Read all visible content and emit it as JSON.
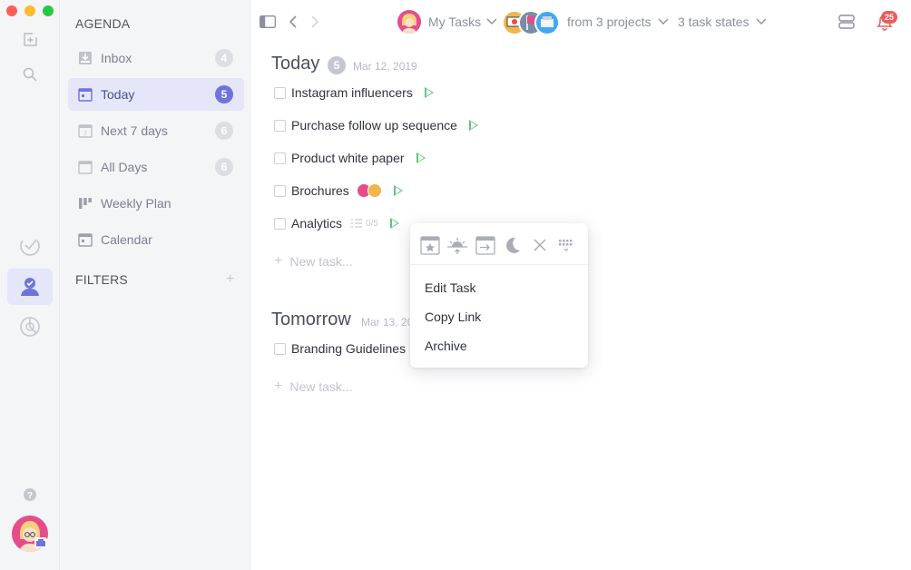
{
  "colors": {
    "accent": "#6e74d9",
    "play": "#5fc87e",
    "notification": "#ef5a5a"
  },
  "rail": {
    "icons": [
      "new-task-icon",
      "search-icon",
      "check-circle-icon",
      "user-check-icon",
      "chart-icon",
      "help-icon"
    ]
  },
  "sidebar": {
    "agenda_title": "AGENDA",
    "items": [
      {
        "label": "Inbox",
        "badge": "4",
        "icon": "inbox-icon"
      },
      {
        "label": "Today",
        "badge": "5",
        "icon": "calendar-today-icon"
      },
      {
        "label": "Next 7 days",
        "badge": "6",
        "icon": "calendar-7-icon"
      },
      {
        "label": "All Days",
        "badge": "6",
        "icon": "calendar-all-icon"
      },
      {
        "label": "Weekly Plan",
        "badge": "",
        "icon": "weekly-plan-icon"
      },
      {
        "label": "Calendar",
        "badge": "",
        "icon": "calendar-icon"
      }
    ],
    "filters_title": "FILTERS",
    "filters_add": "+"
  },
  "header": {
    "my_tasks": "My Tasks",
    "projects": "from 3 projects",
    "task_states": "3 task states",
    "notification_count": "25"
  },
  "today": {
    "title": "Today",
    "count": "5",
    "date": "Mar 12, 2019",
    "tasks": [
      {
        "label": "Instagram influencers"
      },
      {
        "label": "Purchase follow up sequence"
      },
      {
        "label": "Product white paper"
      },
      {
        "label": "Brochures"
      },
      {
        "label": "Analytics",
        "checklist": "0/5"
      }
    ],
    "new_task": "New task..."
  },
  "tomorrow": {
    "title": "Tomorrow",
    "date": "Mar 13, 2019",
    "tasks": [
      {
        "label": "Branding Guidelines"
      }
    ],
    "new_task": "New task..."
  },
  "popup": {
    "tools": [
      "today-star-icon",
      "sunrise-icon",
      "move-next-icon",
      "moon-icon",
      "close-icon",
      "grid-more-icon"
    ],
    "menu": [
      {
        "label": "Edit Task"
      },
      {
        "label": "Copy Link"
      },
      {
        "label": "Archive"
      }
    ]
  }
}
